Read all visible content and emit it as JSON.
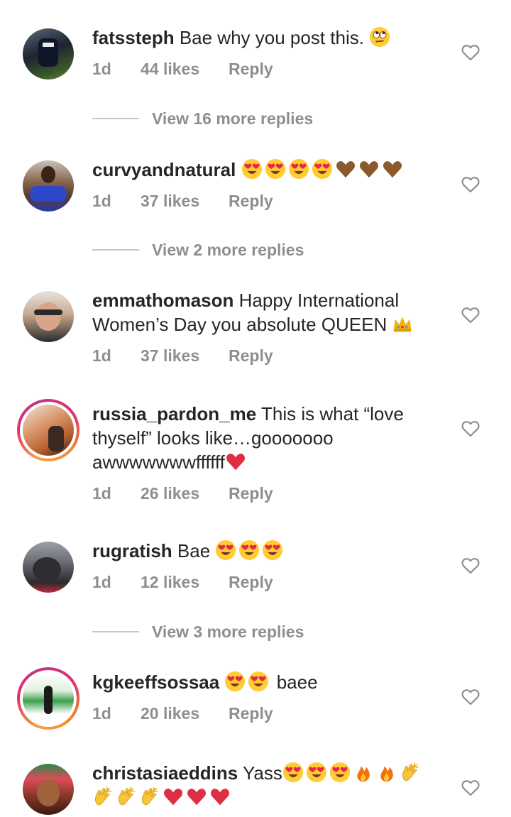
{
  "comments": [
    {
      "username": "fatssteph",
      "text": "Bae why you post this.",
      "time": "1d",
      "likes": "44 likes",
      "reply": "Reply",
      "view_more": "View 16 more replies",
      "emoji": "face-with-rolling-eyes"
    },
    {
      "username": "curvyandnatural",
      "text": "",
      "time": "1d",
      "likes": "37 likes",
      "reply": "Reply",
      "view_more": "View 2 more replies",
      "emoji": "heart-eyes x4, brown-heart x3"
    },
    {
      "username": "emmathomason",
      "text": "Happy International Women’s Day you absolute QUEEN",
      "time": "1d",
      "likes": "37 likes",
      "reply": "Reply",
      "emoji": "crown"
    },
    {
      "username": "russia_pardon_me",
      "text": "This is what “love thyself” looks like…gooooooo awwwwwwwffffff",
      "time": "1d",
      "likes": "26 likes",
      "reply": "Reply",
      "emoji": "red-heart"
    },
    {
      "username": "rugratish",
      "text": "Bae",
      "time": "1d",
      "likes": "12 likes",
      "reply": "Reply",
      "view_more": "View 3 more replies",
      "emoji": "heart-eyes x3"
    },
    {
      "username": "kgkeeffsossaa",
      "text": "baee",
      "time": "1d",
      "likes": "20 likes",
      "reply": "Reply",
      "emoji": "heart-eyes x2"
    },
    {
      "username": "christasiaeddins",
      "text": "Yass",
      "emoji": "heart-eyes x3, fire x2, clapping-hands x4, red-heart x3"
    }
  ],
  "icons": {
    "like": "heart-outline-icon"
  },
  "colors": {
    "text": "#262626",
    "muted": "#8e8e8e",
    "divider": "#c7c7c7"
  }
}
